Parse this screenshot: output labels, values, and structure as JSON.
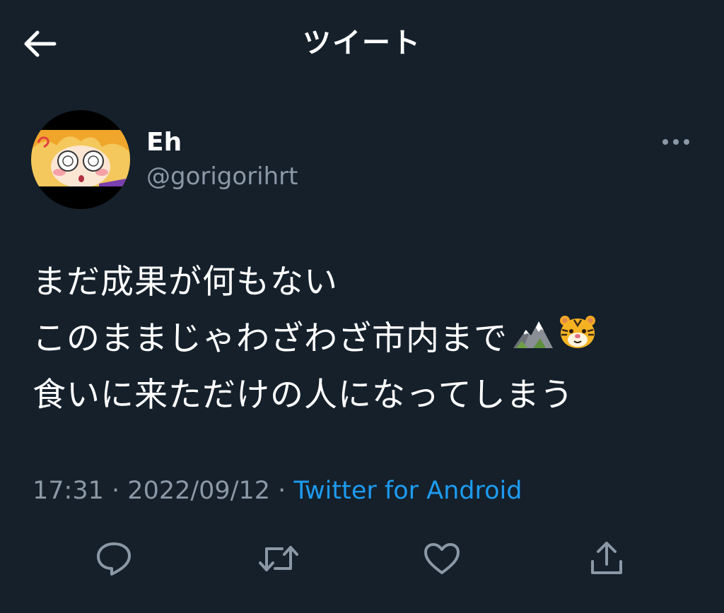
{
  "header": {
    "title": "ツイート",
    "back_icon": "arrow-left-icon"
  },
  "tweet": {
    "author": {
      "name": "Eh",
      "handle": "@gorigorihrt",
      "avatar": "anime-girl-avatar"
    },
    "lines": [
      "まだ成果が何もない",
      "このままじゃわざわざ市内まで",
      "食いに来ただけの人になってしまう"
    ],
    "emojis": [
      "mountain-emoji",
      "tiger-face-emoji"
    ],
    "time": "17:31",
    "date": "2022/09/12",
    "separator": "·",
    "source": "Twitter for Android"
  },
  "actions": [
    "reply-icon",
    "retweet-icon",
    "like-icon",
    "share-icon"
  ],
  "colors": {
    "background": "#15202b",
    "text": "#ffffff",
    "secondary": "#8b98a5",
    "link": "#1d9bf0"
  }
}
